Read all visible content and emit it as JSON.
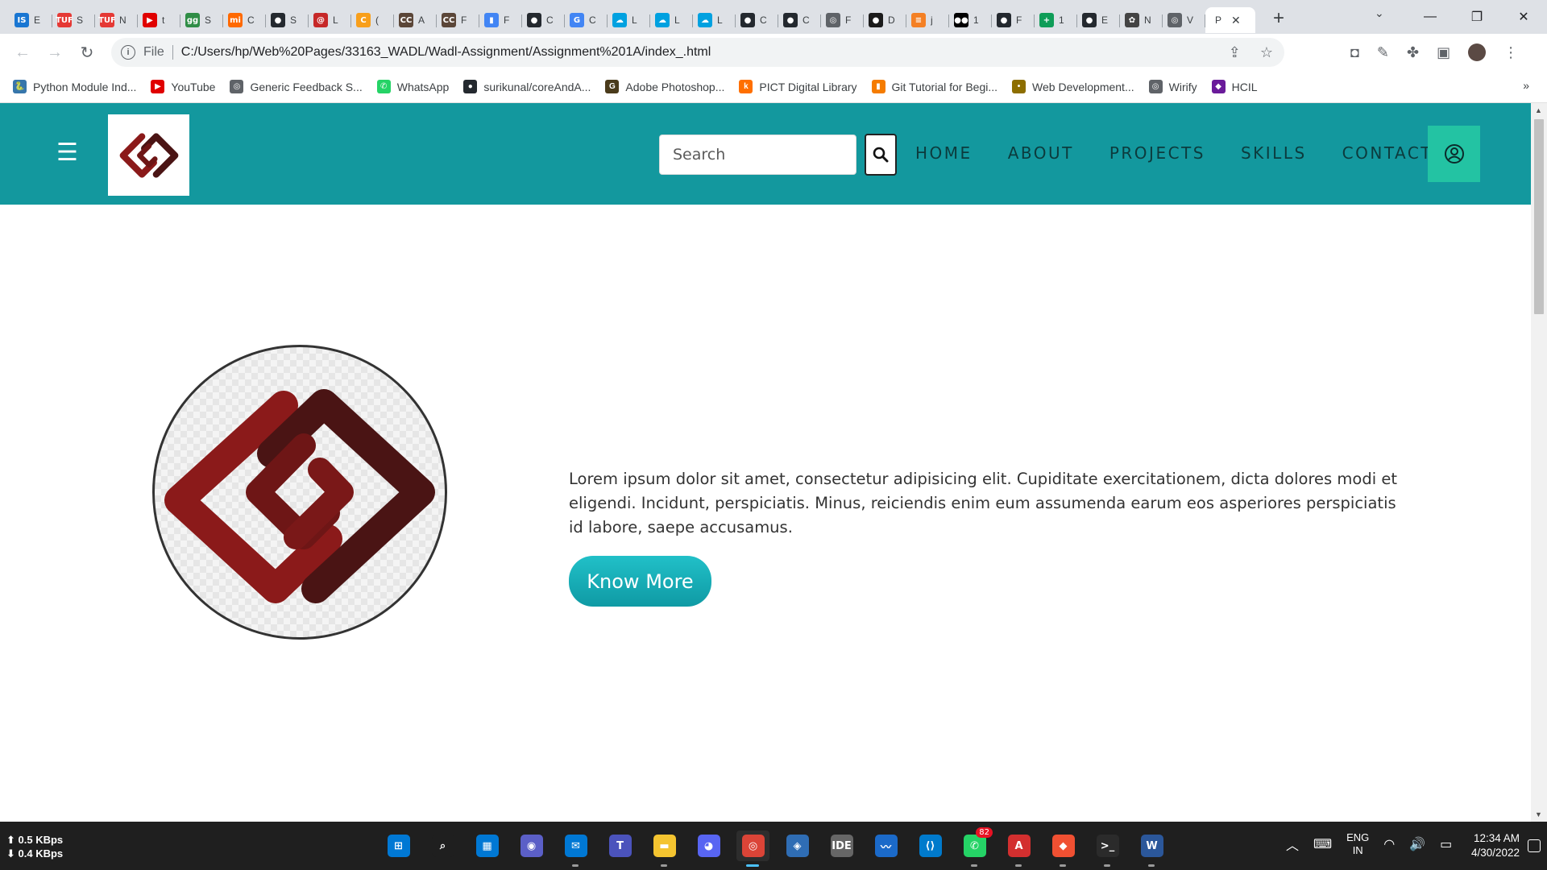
{
  "browser": {
    "tabs": [
      {
        "icon": "edpuzzle-icon",
        "title": "E",
        "color": "#1976d2",
        "glyph": "IS"
      },
      {
        "icon": "tuf-icon",
        "title": "S",
        "color": "#e53935",
        "glyph": "TUF"
      },
      {
        "icon": "tuf-icon",
        "title": "N",
        "color": "#e53935",
        "glyph": "TUF"
      },
      {
        "icon": "youtube-icon",
        "title": "t",
        "color": "#e00000",
        "glyph": "▶"
      },
      {
        "icon": "geeksforgeeks-icon",
        "title": "S",
        "color": "#2f8d46",
        "glyph": "gg"
      },
      {
        "icon": "xiaomi-icon",
        "title": "C",
        "color": "#ff6900",
        "glyph": "mi"
      },
      {
        "icon": "github-icon",
        "title": "S",
        "color": "#24292f",
        "glyph": "●"
      },
      {
        "icon": "codechef-icon",
        "title": "L",
        "color": "#c62828",
        "glyph": "@"
      },
      {
        "icon": "leetcode-icon",
        "title": "(",
        "color": "#f89f1b",
        "glyph": "C"
      },
      {
        "icon": "codechef-icon",
        "title": "A",
        "color": "#5b4638",
        "glyph": "CC"
      },
      {
        "icon": "codechef-icon",
        "title": "F",
        "color": "#5b4638",
        "glyph": "CC"
      },
      {
        "icon": "chart-icon",
        "title": "F",
        "color": "#4285f4",
        "glyph": "▮"
      },
      {
        "icon": "github-icon",
        "title": "C",
        "color": "#24292f",
        "glyph": "●"
      },
      {
        "icon": "google-icon",
        "title": "C",
        "color": "#4285f4",
        "glyph": "G"
      },
      {
        "icon": "salesforce-icon",
        "title": "L",
        "color": "#00a1e0",
        "glyph": "☁"
      },
      {
        "icon": "salesforce-icon",
        "title": "L",
        "color": "#00a1e0",
        "glyph": "☁"
      },
      {
        "icon": "salesforce-icon",
        "title": "L",
        "color": "#00a1e0",
        "glyph": "☁"
      },
      {
        "icon": "github-icon",
        "title": "C",
        "color": "#24292f",
        "glyph": "●"
      },
      {
        "icon": "github-icon",
        "title": "C",
        "color": "#24292f",
        "glyph": "●"
      },
      {
        "icon": "globe-icon",
        "title": "F",
        "color": "#5f6368",
        "glyph": "◎"
      },
      {
        "icon": "upwork-icon",
        "title": "D",
        "color": "#1b1b1b",
        "glyph": "●"
      },
      {
        "icon": "stackoverflow-icon",
        "title": "j",
        "color": "#f48024",
        "glyph": "≡"
      },
      {
        "icon": "medium-icon",
        "title": "1",
        "color": "#000000",
        "glyph": "●●"
      },
      {
        "icon": "github-icon",
        "title": "F",
        "color": "#24292f",
        "glyph": "●"
      },
      {
        "icon": "sheets-icon",
        "title": "1",
        "color": "#0f9d58",
        "glyph": "+"
      },
      {
        "icon": "github-icon",
        "title": "E",
        "color": "#24292f",
        "glyph": "●"
      },
      {
        "icon": "chatgpt-icon",
        "title": "N",
        "color": "#444444",
        "glyph": "✿"
      },
      {
        "icon": "globe-icon",
        "title": "V",
        "color": "#5f6368",
        "glyph": "◎"
      }
    ],
    "active_tab": {
      "title": "P",
      "close": "✕"
    },
    "new_tab": "+",
    "omnibox": {
      "scheme": "File",
      "url": "C:/Users/hp/Web%20Pages/33163_WADL/Wadl-Assignment/Assignment%201A/index_.html"
    },
    "bookmarks": [
      {
        "icon": "python-icon",
        "label": "Python Module Ind...",
        "color": "#3776ab",
        "glyph": "🐍"
      },
      {
        "icon": "youtube-icon",
        "label": "YouTube",
        "color": "#e00000",
        "glyph": "▶"
      },
      {
        "icon": "globe-icon",
        "label": "Generic Feedback S...",
        "color": "#5f6368",
        "glyph": "◎"
      },
      {
        "icon": "whatsapp-icon",
        "label": "WhatsApp",
        "color": "#25d366",
        "glyph": "✆"
      },
      {
        "icon": "github-icon",
        "label": "surikunal/coreAndA...",
        "color": "#24292f",
        "glyph": "●"
      },
      {
        "icon": "grammarly-icon",
        "label": "Adobe Photoshop...",
        "color": "#4a3b1b",
        "glyph": "G"
      },
      {
        "icon": "k-icon",
        "label": "PICT Digital Library",
        "color": "#ff6f00",
        "glyph": "k"
      },
      {
        "icon": "bookmark-icon",
        "label": "Git Tutorial for Begi...",
        "color": "#f57c00",
        "glyph": "▮"
      },
      {
        "icon": "bulb-icon",
        "label": "Web Development...",
        "color": "#8d6e00",
        "glyph": "•"
      },
      {
        "icon": "globe-icon",
        "label": "Wirify",
        "color": "#5f6368",
        "glyph": "◎"
      },
      {
        "icon": "hcil-icon",
        "label": "HCIL",
        "color": "#6a1b9a",
        "glyph": "◆"
      }
    ],
    "bookmarks_more": "»"
  },
  "site": {
    "search_placeholder": "Search",
    "nav": [
      "HOME",
      "ABOUT",
      "PROJECTS",
      "SKILLS",
      "CONTACT"
    ],
    "hero_text": "Lorem ipsum dolor sit amet, consectetur adipisicing elit. Cupiditate exercitationem, dicta dolores modi et eligendi. Incidunt, perspiciatis. Minus, reiciendis enim eum assumenda earum eos asperiores perspiciatis id labore, saepe accusamus.",
    "cta_label": "Know More",
    "colors": {
      "navbar": "#13989e",
      "user_button": "#23c3a3",
      "logo_red": "#8b1a1a",
      "logo_dark": "#4a1414"
    }
  },
  "taskbar": {
    "net_up": "0.5 KBps",
    "net_down": "0.4 KBps",
    "apps": [
      {
        "icon": "windows-start-icon",
        "color": "#0078d4",
        "glyph": "⊞",
        "running": false,
        "active": false
      },
      {
        "icon": "search-icon",
        "color": "#1f1f1f",
        "glyph": "⌕",
        "running": false,
        "active": false
      },
      {
        "icon": "widgets-icon",
        "color": "#0078d4",
        "glyph": "▦",
        "running": false,
        "active": false
      },
      {
        "icon": "teams-chat-icon",
        "color": "#5b5fc7",
        "glyph": "◉",
        "running": false,
        "active": false
      },
      {
        "icon": "mail-icon",
        "color": "#0078d4",
        "glyph": "✉",
        "running": true,
        "active": false
      },
      {
        "icon": "teams-icon",
        "color": "#4b53bc",
        "glyph": "T",
        "running": false,
        "active": false
      },
      {
        "icon": "file-explorer-icon",
        "color": "#f4c430",
        "glyph": "▬",
        "running": true,
        "active": false
      },
      {
        "icon": "discord-icon",
        "color": "#5865f2",
        "glyph": "◕",
        "running": false,
        "active": false
      },
      {
        "icon": "chrome-icon",
        "color": "#db4437",
        "glyph": "◎",
        "running": true,
        "active": true
      },
      {
        "icon": "virtualbox-icon",
        "color": "#2f6db4",
        "glyph": "◈",
        "running": false,
        "active": false
      },
      {
        "icon": "mplab-icon",
        "color": "#666666",
        "glyph": "IDE",
        "running": false,
        "active": false
      },
      {
        "icon": "whiteboard-icon",
        "color": "#1b6ac9",
        "glyph": "〰",
        "running": false,
        "active": false
      },
      {
        "icon": "vscode-icon",
        "color": "#007acc",
        "glyph": "⟨⟩",
        "running": false,
        "active": false
      },
      {
        "icon": "whatsapp-icon",
        "color": "#25d366",
        "glyph": "✆",
        "running": true,
        "active": false,
        "badge": "82"
      },
      {
        "icon": "acrobat-icon",
        "color": "#d32f2f",
        "glyph": "A",
        "running": true,
        "active": false
      },
      {
        "icon": "git-icon",
        "color": "#f05032",
        "glyph": "◆",
        "running": true,
        "active": false
      },
      {
        "icon": "terminal-icon",
        "color": "#2b2b2b",
        "glyph": ">_",
        "running": true,
        "active": false
      },
      {
        "icon": "word-icon",
        "color": "#2b579a",
        "glyph": "W",
        "running": true,
        "active": false
      }
    ],
    "lang_line1": "ENG",
    "lang_line2": "IN",
    "time": "12:34 AM",
    "date": "4/30/2022"
  }
}
